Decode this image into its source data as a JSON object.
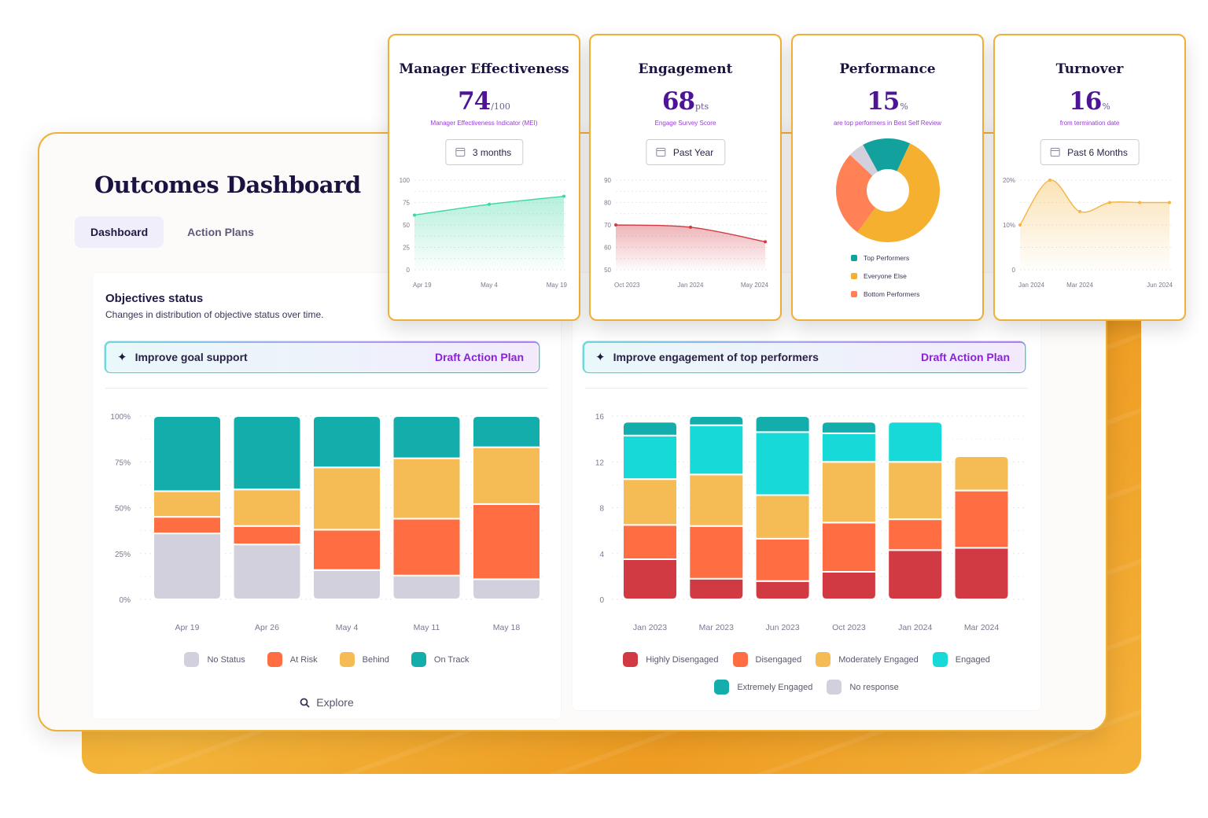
{
  "dashboard": {
    "title": "Outcomes Dashboard",
    "tabs": [
      {
        "label": "Dashboard",
        "active": true
      },
      {
        "label": "Action Plans",
        "active": false
      }
    ]
  },
  "objectives_panel": {
    "title": "Objectives status",
    "subtitle": "Changes in distribution of objective status over time.",
    "banner": {
      "icon": "sparkle-icon",
      "text": "Improve goal support",
      "action": "Draft Action Plan"
    },
    "explore_label": "Explore"
  },
  "engagement_panel": {
    "banner": {
      "icon": "sparkle-icon",
      "text": "Improve engagement of top performers",
      "action": "Draft Action Plan"
    }
  },
  "kpis": [
    {
      "title": "Manager Effectiveness",
      "value": "74",
      "unit": "/100",
      "caption": "Manager Effectiveness Indicator (MEI)",
      "period": "3 months"
    },
    {
      "title": "Engagement",
      "value": "68",
      "unit": "pts",
      "caption": "Engage Survey Score",
      "period": "Past Year"
    },
    {
      "title": "Performance",
      "value": "15",
      "unit": "%",
      "caption": "are top performers in Best Self Review"
    },
    {
      "title": "Turnover",
      "value": "16",
      "unit": "%",
      "caption": "from termination date",
      "period": "Past 6 Months"
    }
  ],
  "colors": {
    "accent_purple": "#4d1596",
    "link_purple": "#8a22d6",
    "border_orange": "#f0b038",
    "no_status": "#d2d0dc",
    "at_risk": "#ff6d42",
    "behind": "#f5bc55",
    "on_track": "#13aeab",
    "highly_disengaged": "#d13a42",
    "engaged": "#17dad8",
    "extremely_engaged": "#13aeab",
    "everyone_else": "#f4b02e",
    "bottom_performers": "#ff8155",
    "mei_line": "#3dd6a0",
    "engagement_line": "#d13a42",
    "turnover_line": "#f4b541"
  },
  "chart_data": [
    {
      "id": "objectives",
      "type": "bar",
      "stacked": true,
      "title": "Objectives status",
      "categories": [
        "Apr 19",
        "Apr 26",
        "May 4",
        "May 11",
        "May 18"
      ],
      "yticks": [
        "0%",
        "25%",
        "50%",
        "75%",
        "100%"
      ],
      "ylim": [
        0,
        100
      ],
      "series": [
        {
          "name": "No Status",
          "color": "#d2d0dc",
          "values": [
            36,
            30,
            16,
            13,
            11
          ]
        },
        {
          "name": "At Risk",
          "color": "#ff6d42",
          "values": [
            9,
            10,
            22,
            31,
            41
          ]
        },
        {
          "name": "Behind",
          "color": "#f5bc55",
          "values": [
            14,
            20,
            34,
            33,
            31
          ]
        },
        {
          "name": "On Track",
          "color": "#13aeab",
          "values": [
            41,
            40,
            28,
            23,
            17
          ]
        }
      ],
      "legend": "bottom"
    },
    {
      "id": "engagement_distribution",
      "type": "bar",
      "stacked": true,
      "categories": [
        "Jan 2023",
        "Mar 2023",
        "Jun 2023",
        "Oct 2023",
        "Jan 2024",
        "Mar 2024"
      ],
      "yticks": [
        "0",
        "4",
        "8",
        "12",
        "16"
      ],
      "ylim": [
        0,
        16
      ],
      "series": [
        {
          "name": "Highly Disengaged",
          "color": "#d13a42",
          "values": [
            3.5,
            1.8,
            1.6,
            2.4,
            4.3,
            4.5
          ]
        },
        {
          "name": "Disengaged",
          "color": "#ff6d42",
          "values": [
            3.0,
            4.6,
            3.7,
            4.3,
            2.7,
            5.0
          ]
        },
        {
          "name": "Moderately Engaged",
          "color": "#f5bc55",
          "values": [
            4.0,
            4.5,
            3.8,
            5.3,
            5.0,
            3.0
          ]
        },
        {
          "name": "Engaged",
          "color": "#17dad8",
          "values": [
            3.8,
            4.3,
            5.5,
            2.5,
            3.5,
            0
          ]
        },
        {
          "name": "Extremely Engaged",
          "color": "#13aeab",
          "values": [
            1.2,
            0.8,
            1.4,
            1.0,
            0,
            0
          ]
        },
        {
          "name": "No response",
          "color": "#d2d0dc",
          "values": [
            0,
            0,
            0,
            0,
            0,
            0
          ]
        }
      ],
      "legend": "bottom"
    },
    {
      "id": "mei_trend",
      "type": "area",
      "x": [
        "Apr 19",
        "May 4",
        "May 19"
      ],
      "xticks": [
        "Apr 19",
        "May 4",
        "May 19"
      ],
      "values": [
        61,
        73,
        82
      ],
      "yticks": [
        "0",
        "25",
        "50",
        "75",
        "100"
      ],
      "ylim": [
        0,
        100
      ],
      "color": "#3dd6a0"
    },
    {
      "id": "engagement_trend",
      "type": "area",
      "x": [
        "Oct 2023",
        "Jan 2024",
        "May 2024"
      ],
      "xticks": [
        "Oct 2023",
        "Jan 2024",
        "May 2024"
      ],
      "values": [
        70,
        69,
        62.5
      ],
      "yticks": [
        "50",
        "60",
        "70",
        "80",
        "90"
      ],
      "ylim": [
        50,
        90
      ],
      "color": "#d13a42"
    },
    {
      "id": "performance_distribution",
      "type": "pie",
      "donut": true,
      "slices": [
        {
          "name": "Top Performers",
          "value": 15,
          "color": "#13a19e",
          "legend": true
        },
        {
          "name": "Everyone Else",
          "value": 53,
          "color": "#f4b02e",
          "legend": true
        },
        {
          "name": "Bottom Performers",
          "value": 27,
          "color": "#ff8155",
          "legend": true
        },
        {
          "name": "Unrated",
          "value": 5,
          "color": "#d2d0dc",
          "legend": false
        }
      ]
    },
    {
      "id": "turnover_trend",
      "type": "area",
      "x": [
        "Jan 2024",
        "Feb 2024",
        "Mar 2024",
        "Apr 2024",
        "May 2024",
        "Jun 2024"
      ],
      "xticks": [
        "Jan 2024",
        "Mar 2024",
        "Jun 2024"
      ],
      "values": [
        10,
        20,
        13,
        15,
        15,
        15
      ],
      "yticks": [
        "0",
        "10%",
        "20%"
      ],
      "ylim": [
        0,
        20
      ],
      "color": "#f4b541"
    }
  ]
}
